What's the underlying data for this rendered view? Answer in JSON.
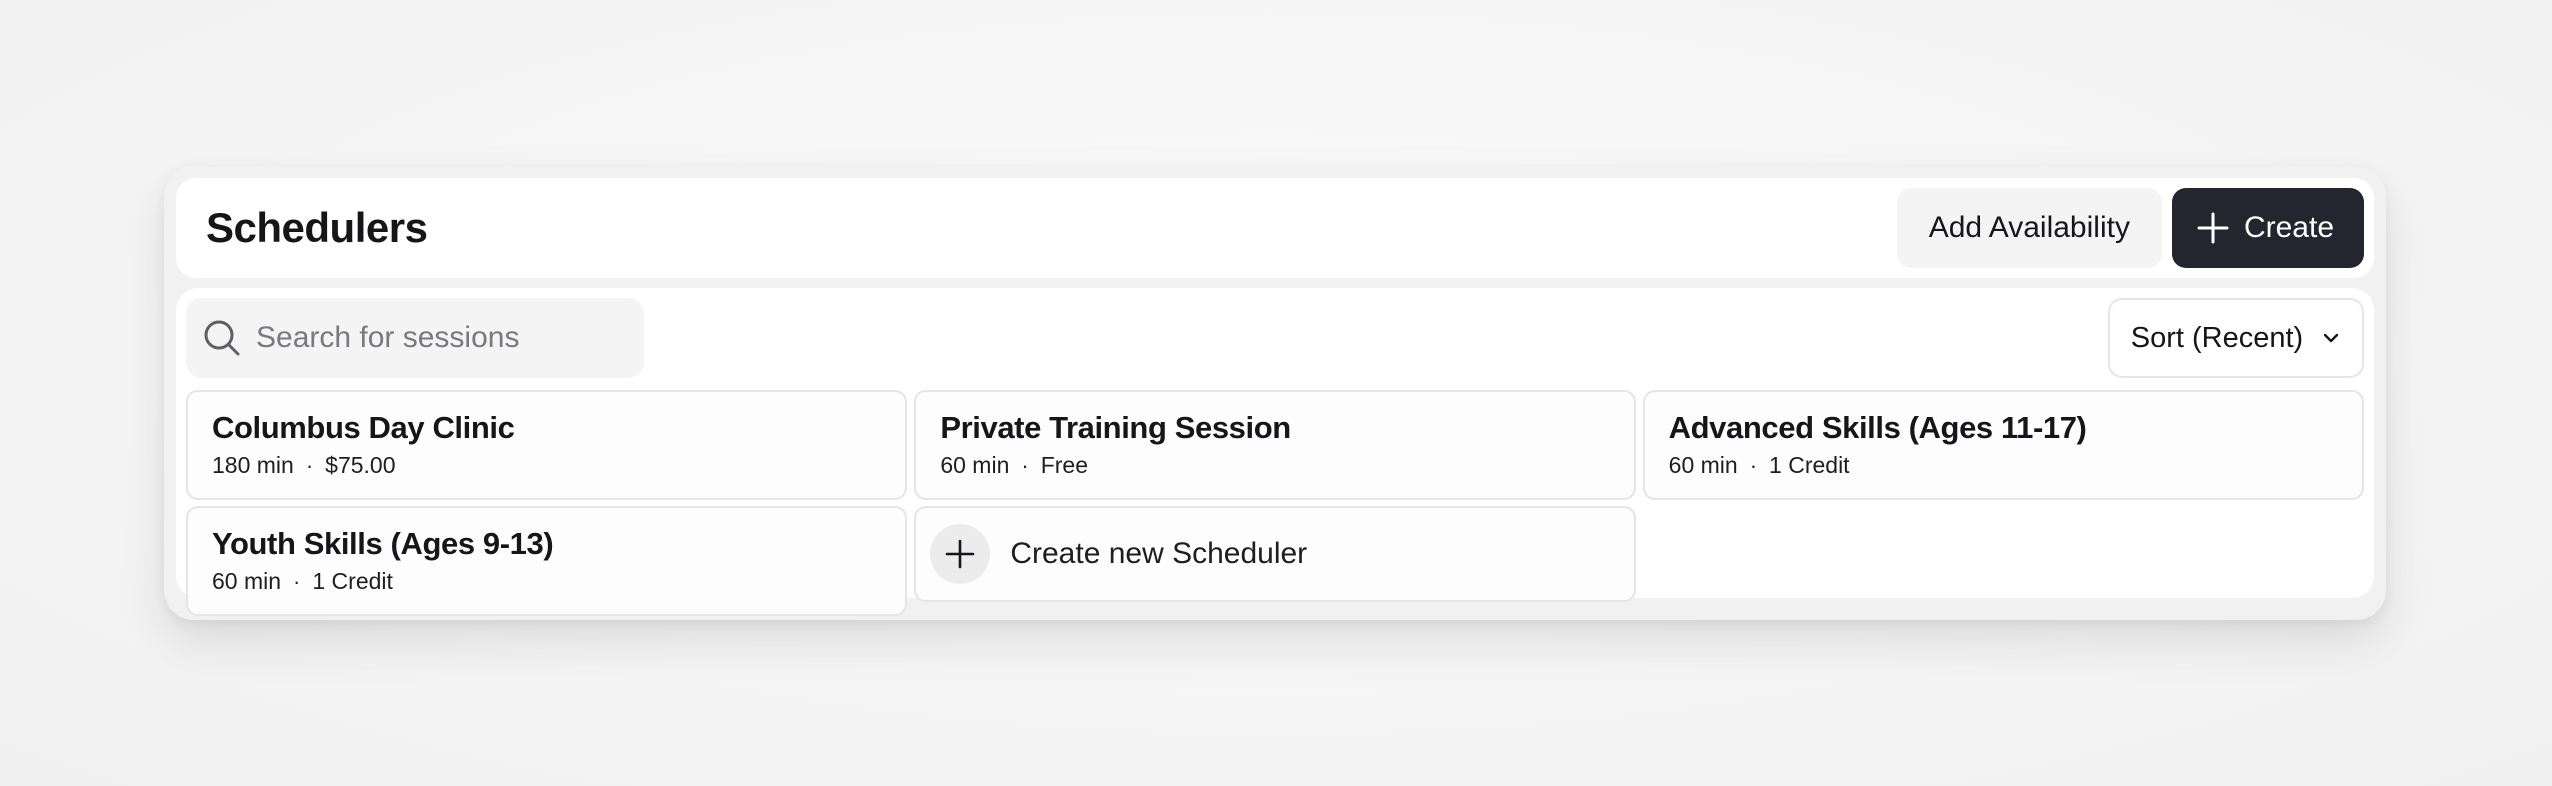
{
  "header": {
    "title": "Schedulers",
    "add_availability_label": "Add Availability",
    "create_label": "Create"
  },
  "toolbar": {
    "search_placeholder": "Search for sessions",
    "sort_label": "Sort (Recent)"
  },
  "schedulers": [
    {
      "title": "Columbus Day Clinic",
      "duration": "180 min",
      "price": "$75.00"
    },
    {
      "title": "Private Training Session",
      "duration": "60 min",
      "price": "Free"
    },
    {
      "title": "Advanced Skills (Ages 11-17)",
      "duration": "60 min",
      "price": "1 Credit"
    },
    {
      "title": "Youth Skills (Ages 9-13)",
      "duration": "60 min",
      "price": "1 Credit"
    }
  ],
  "create_card": {
    "label": "Create new Scheduler"
  },
  "separator": "·",
  "colors": {
    "primary_button": "#24252f",
    "panel_background": "#f1f1f1",
    "card_border": "#e5e5e5"
  },
  "icons": {
    "create": "plus-icon",
    "search": "search-icon",
    "sort": "chevron-down-icon",
    "create_card": "plus-icon"
  }
}
